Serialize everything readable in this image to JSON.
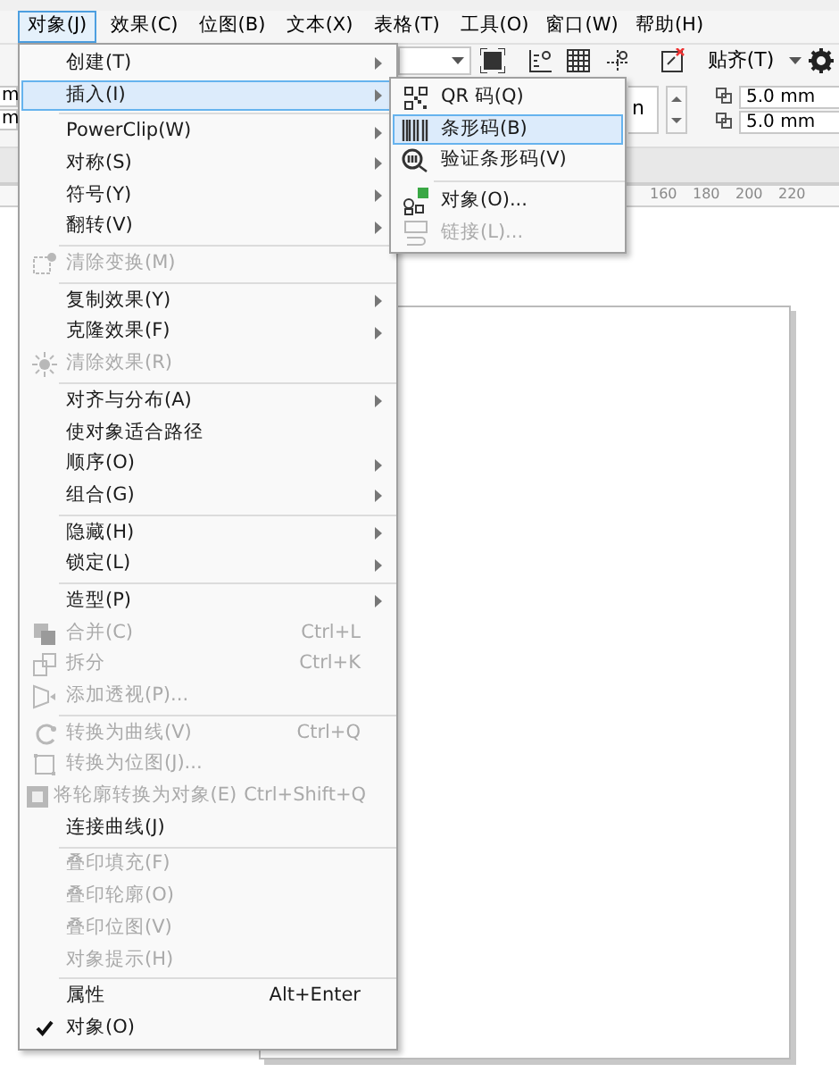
{
  "menubar": [
    {
      "label": "对象(J)",
      "selected": true
    },
    {
      "label": "效果(C)",
      "selected": false
    },
    {
      "label": "位图(B)",
      "selected": false
    },
    {
      "label": "文本(X)",
      "selected": false
    },
    {
      "label": "表格(T)",
      "selected": false
    },
    {
      "label": "工具(O)",
      "selected": false
    },
    {
      "label": "窗口(W)",
      "selected": false
    },
    {
      "label": "帮助(H)",
      "selected": false
    }
  ],
  "toolbar": {
    "snap_label": "贴齐(T)"
  },
  "property_bar": {
    "left_fields": [
      "m",
      "m"
    ],
    "partial_field": "n",
    "offsets": [
      "5.0 mm",
      "5.0 mm"
    ]
  },
  "ruler": {
    "labels": [
      "160",
      "180",
      "200",
      "220"
    ]
  },
  "menu": [
    {
      "kind": "item",
      "label": "创建(T)",
      "submenu": true,
      "disabled": false,
      "checked": false,
      "selected": false
    },
    {
      "kind": "item",
      "label": "插入(I)",
      "submenu": true,
      "disabled": false,
      "checked": false,
      "selected": true
    },
    {
      "kind": "separator"
    },
    {
      "kind": "item",
      "label": "PowerClip(W)",
      "submenu": true,
      "disabled": false,
      "checked": false,
      "selected": false
    },
    {
      "kind": "item",
      "label": "对称(S)",
      "submenu": true,
      "disabled": false,
      "checked": false,
      "selected": false
    },
    {
      "kind": "item",
      "label": "符号(Y)",
      "submenu": true,
      "disabled": false,
      "checked": false,
      "selected": false
    },
    {
      "kind": "item",
      "label": "翻转(V)",
      "submenu": true,
      "disabled": false,
      "checked": false,
      "selected": false
    },
    {
      "kind": "separator"
    },
    {
      "kind": "item",
      "label": "清除变换(M)",
      "submenu": false,
      "disabled": true,
      "checked": false,
      "selected": false
    },
    {
      "kind": "separator"
    },
    {
      "kind": "item",
      "label": "复制效果(Y)",
      "submenu": true,
      "disabled": false,
      "checked": false,
      "selected": false
    },
    {
      "kind": "item",
      "label": "克隆效果(F)",
      "submenu": true,
      "disabled": false,
      "checked": false,
      "selected": false
    },
    {
      "kind": "item",
      "label": "清除效果(R)",
      "submenu": false,
      "disabled": true,
      "checked": false,
      "selected": false
    },
    {
      "kind": "separator"
    },
    {
      "kind": "item",
      "label": "对齐与分布(A)",
      "submenu": true,
      "disabled": false,
      "checked": false,
      "selected": false
    },
    {
      "kind": "item",
      "label": "使对象适合路径",
      "submenu": false,
      "disabled": false,
      "checked": false,
      "selected": false
    },
    {
      "kind": "item",
      "label": "顺序(O)",
      "submenu": true,
      "disabled": false,
      "checked": false,
      "selected": false
    },
    {
      "kind": "item",
      "label": "组合(G)",
      "submenu": true,
      "disabled": false,
      "checked": false,
      "selected": false
    },
    {
      "kind": "separator"
    },
    {
      "kind": "item",
      "label": "隐藏(H)",
      "submenu": true,
      "disabled": false,
      "checked": false,
      "selected": false
    },
    {
      "kind": "item",
      "label": "锁定(L)",
      "submenu": true,
      "disabled": false,
      "checked": false,
      "selected": false
    },
    {
      "kind": "separator"
    },
    {
      "kind": "item",
      "label": "造型(P)",
      "submenu": true,
      "disabled": false,
      "checked": false,
      "selected": false
    },
    {
      "kind": "item",
      "label": "合并(C)",
      "shortcut": "Ctrl+L",
      "submenu": false,
      "disabled": true,
      "checked": false,
      "selected": false
    },
    {
      "kind": "item",
      "label": "拆分",
      "shortcut": "Ctrl+K",
      "submenu": false,
      "disabled": true,
      "checked": false,
      "selected": false
    },
    {
      "kind": "item",
      "label": "添加透视(P)...",
      "submenu": false,
      "disabled": true,
      "checked": false,
      "selected": false
    },
    {
      "kind": "separator"
    },
    {
      "kind": "item",
      "label": "转换为曲线(V)",
      "shortcut": "Ctrl+Q",
      "submenu": false,
      "disabled": true,
      "checked": false,
      "selected": false
    },
    {
      "kind": "item",
      "label": "转换为位图(J)...",
      "submenu": false,
      "disabled": true,
      "checked": false,
      "selected": false
    },
    {
      "kind": "item",
      "label": "将轮廓转换为对象(E)",
      "shortcut": "Ctrl+Shift+Q",
      "submenu": false,
      "disabled": true,
      "checked": false,
      "selected": false
    },
    {
      "kind": "item",
      "label": "连接曲线(J)",
      "submenu": false,
      "disabled": false,
      "checked": false,
      "selected": false
    },
    {
      "kind": "separator"
    },
    {
      "kind": "item",
      "label": "叠印填充(F)",
      "submenu": false,
      "disabled": true,
      "checked": false,
      "selected": false
    },
    {
      "kind": "item",
      "label": "叠印轮廓(O)",
      "submenu": false,
      "disabled": true,
      "checked": false,
      "selected": false
    },
    {
      "kind": "item",
      "label": "叠印位图(V)",
      "submenu": false,
      "disabled": true,
      "checked": false,
      "selected": false
    },
    {
      "kind": "item",
      "label": "对象提示(H)",
      "submenu": false,
      "disabled": true,
      "checked": false,
      "selected": false
    },
    {
      "kind": "separator"
    },
    {
      "kind": "item",
      "label": "属性",
      "shortcut": "Alt+Enter",
      "submenu": false,
      "disabled": false,
      "checked": false,
      "selected": false
    },
    {
      "kind": "item",
      "label": "对象(O)",
      "submenu": false,
      "disabled": false,
      "checked": true,
      "selected": false
    }
  ],
  "submenu": [
    {
      "kind": "item",
      "label": "QR 码(Q)",
      "disabled": false,
      "selected": false
    },
    {
      "kind": "item",
      "label": "条形码(B)",
      "disabled": false,
      "selected": true
    },
    {
      "kind": "item",
      "label": "验证条形码(V)",
      "disabled": false,
      "selected": false
    },
    {
      "kind": "separator"
    },
    {
      "kind": "item",
      "label": "对象(O)...",
      "disabled": false,
      "selected": false
    },
    {
      "kind": "item",
      "label": "链接(L)...",
      "disabled": true,
      "selected": false
    }
  ]
}
